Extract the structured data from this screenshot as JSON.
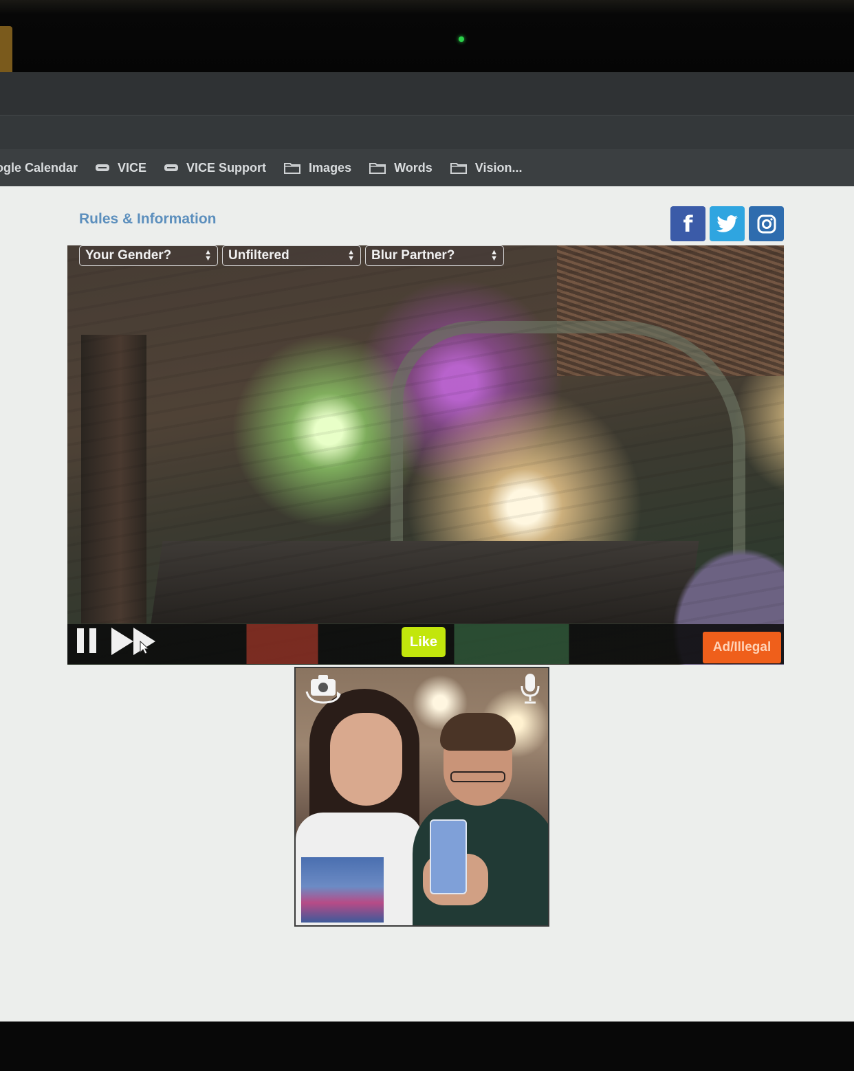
{
  "browser": {
    "bookmarks": [
      {
        "label": "ogle Calendar",
        "icon": "none"
      },
      {
        "label": "VICE",
        "icon": "link-icon"
      },
      {
        "label": "VICE Support",
        "icon": "link-icon"
      },
      {
        "label": "Images",
        "icon": "folder-icon"
      },
      {
        "label": "Words",
        "icon": "folder-icon"
      },
      {
        "label": "Vision...",
        "icon": "folder-icon"
      }
    ]
  },
  "page": {
    "rules_link": "Rules & Information",
    "social": [
      {
        "name": "facebook",
        "glyph": "f",
        "color": "#3b5ba8"
      },
      {
        "name": "twitter",
        "glyph": "twitter-bird",
        "color": "#2fa5e0"
      },
      {
        "name": "instagram",
        "glyph": "instagram-camera",
        "color": "#2e6cae"
      }
    ],
    "filters": {
      "gender": "Your Gender?",
      "filter": "Unfiltered",
      "blur": "Blur Partner?"
    },
    "controls": {
      "like_label": "Like",
      "report_label": "Ad/Illegal",
      "like_color": "#c2e60c",
      "report_color": "#ef5f1b"
    },
    "self_view": {
      "switch_camera_icon": "camera-switch-icon",
      "mic_icon": "microphone-icon"
    }
  }
}
